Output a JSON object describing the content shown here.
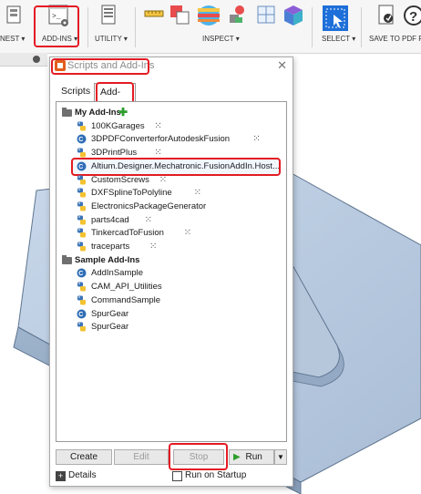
{
  "toolbar": {
    "manage_label": "NEST ▾",
    "addins_label": "ADD-INS ▾",
    "utility_label": "UTILITY ▾",
    "inspect_label": "INSPECT ▾",
    "select_label": "SELECT ▾",
    "save_pdf_label": "SAVE TO PDF FC"
  },
  "dialog": {
    "title": "Scripts and Add-Ins",
    "close": "✕",
    "tabs": [
      "Scripts",
      "Add-Ins"
    ],
    "my_addins_header": "My Add-Ins",
    "my_addins": [
      {
        "name": "100KGarages",
        "icon": "python-icon",
        "loading": true
      },
      {
        "name": "3DPDFConverterforAutodeskFusion",
        "icon": "csharp-icon",
        "loading": true
      },
      {
        "name": "3DPrintPlus",
        "icon": "python-icon",
        "loading": true
      },
      {
        "name": "Altium.Designer.Mechatronic.FusionAddIn.Host...",
        "icon": "csharp-icon",
        "loading": false
      },
      {
        "name": "CustomScrews",
        "icon": "python-icon",
        "loading": true
      },
      {
        "name": "DXFSplineToPolyline",
        "icon": "python-icon",
        "loading": true
      },
      {
        "name": "ElectronicsPackageGenerator",
        "icon": "python-icon",
        "loading": false
      },
      {
        "name": "parts4cad",
        "icon": "python-icon",
        "loading": true
      },
      {
        "name": "TinkercadToFusion",
        "icon": "python-icon",
        "loading": true
      },
      {
        "name": "traceparts",
        "icon": "python-icon",
        "loading": true
      }
    ],
    "sample_addins_header": "Sample Add-Ins",
    "sample_addins": [
      {
        "name": "AddInSample",
        "icon": "csharp-icon"
      },
      {
        "name": "CAM_API_Utilities",
        "icon": "python-icon"
      },
      {
        "name": "CommandSample",
        "icon": "python-icon"
      },
      {
        "name": "SpurGear",
        "icon": "csharp-icon"
      },
      {
        "name": "SpurGear",
        "icon": "python-icon"
      }
    ],
    "buttons": {
      "create": "Create",
      "edit": "Edit",
      "stop": "Stop",
      "run": "Run"
    },
    "details_label": "Details",
    "run_on_startup_label": "Run on Startup"
  },
  "colors": {
    "highlight_red": "#e31b23",
    "accent_blue": "#1e6fd9"
  }
}
